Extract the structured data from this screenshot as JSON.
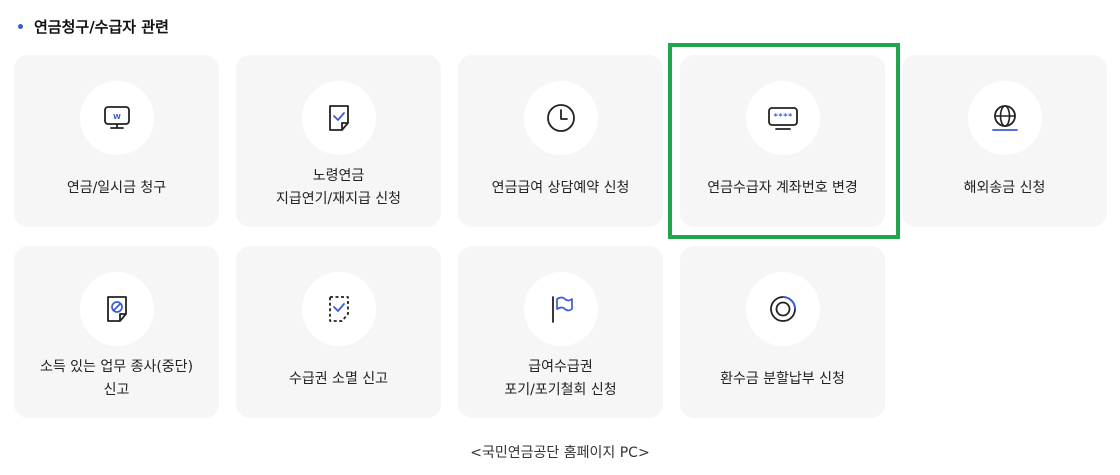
{
  "section": {
    "title": "연금청구/수급자 관련"
  },
  "cards": [
    {
      "label": "연금/일시금 청구",
      "icon": "monitor-won-icon"
    },
    {
      "label": "노령연금\n지급연기/재지급 신청",
      "icon": "document-check-icon"
    },
    {
      "label": "연금급여 상담예약 신청",
      "icon": "clock-icon"
    },
    {
      "label": "연금수급자 계좌번호 변경",
      "icon": "monitor-password-icon"
    },
    {
      "label": "해외송금 신청",
      "icon": "globe-icon"
    },
    {
      "label": "소득 있는 업무 종사(중단)\n신고",
      "icon": "document-block-icon"
    },
    {
      "label": "수급권 소멸 신고",
      "icon": "dashed-document-check-icon"
    },
    {
      "label": "급여수급권\n포기/포기철회 신청",
      "icon": "flag-icon"
    },
    {
      "label": "환수금 분할납부 신청",
      "icon": "pie-ring-icon"
    }
  ],
  "monitor_icon_text": "W",
  "password_mask": "****",
  "caption": "<국민연금공단 홈페이지 PC>",
  "colors": {
    "accent": "#3b5bdb",
    "highlight": "#1fa64a",
    "card_bg": "#f6f6f7"
  }
}
